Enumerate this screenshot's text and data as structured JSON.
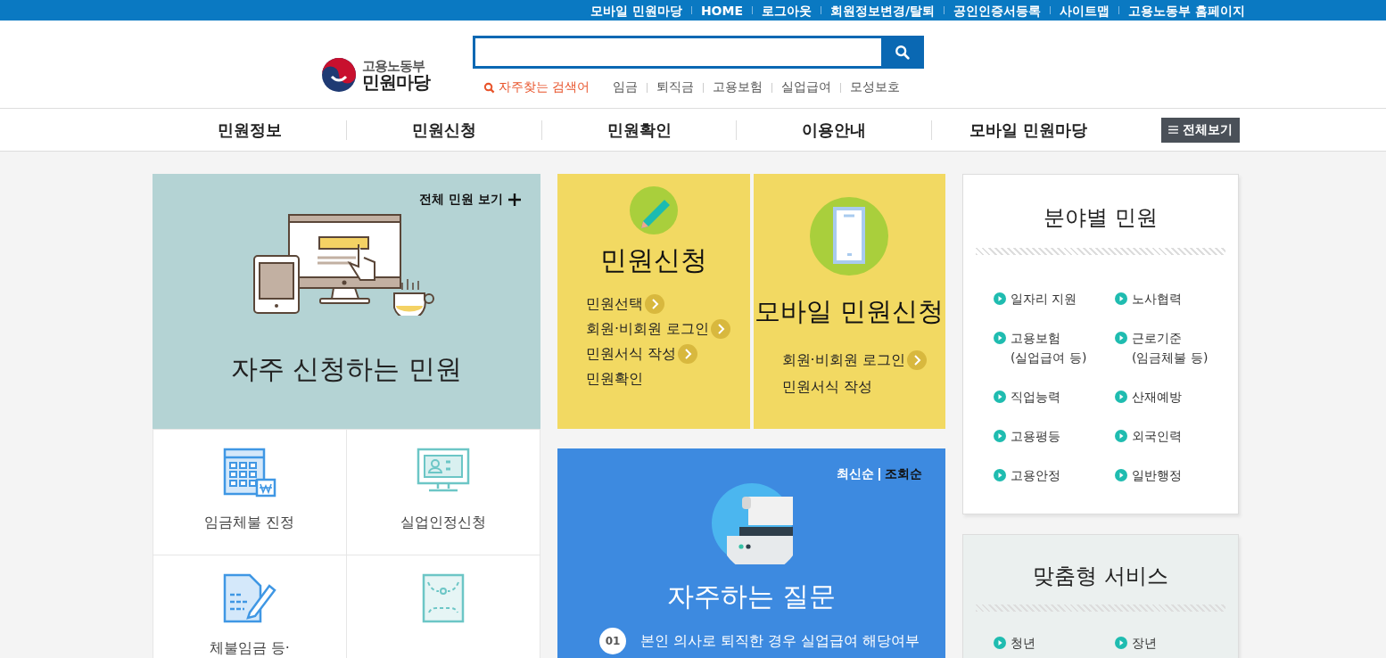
{
  "top_links": [
    "모바일 민원마당",
    "HOME",
    "로그아웃",
    "회원정보변경/탈퇴",
    "공인인증서등록",
    "사이트맵",
    "고용노동부 홈페이지"
  ],
  "logo": {
    "ministry": "고용노동부",
    "service": "민원마당"
  },
  "popular": {
    "label": "자주찾는 검색어",
    "keywords": [
      "임금",
      "퇴직금",
      "고용보험",
      "실업급여",
      "모성보호"
    ]
  },
  "nav": {
    "items": [
      "민원정보",
      "민원신청",
      "민원확인",
      "이용안내",
      "모바일 민원마당"
    ],
    "all_menu": "전체보기"
  },
  "frequent": {
    "view_all": "전체 민원 보기",
    "title": "자주 신청하는 민원",
    "tiles": [
      {
        "kind": "wage",
        "label": "임금체불 진정"
      },
      {
        "kind": "monitor",
        "label": "실업인정신청"
      },
      {
        "kind": "document",
        "label": "체불임금 등·"
      },
      {
        "kind": "envelope"
      }
    ]
  },
  "apply": {
    "title": "민원신청",
    "links": [
      {
        "label": "민원선택",
        "arrow": true
      },
      {
        "label": "회원·비회원 로그인",
        "arrow": true
      },
      {
        "label": "민원서식 작성",
        "arrow": true
      },
      {
        "label": "민원확인",
        "arrow": false
      }
    ]
  },
  "mobile": {
    "title": "모바일 민원신청",
    "links": [
      {
        "label": "회원·비회원 로그인",
        "arrow": true
      },
      {
        "label": "민원서식 작성",
        "arrow": false
      }
    ]
  },
  "faq": {
    "sort": [
      {
        "label": "최신순",
        "selected": true
      },
      {
        "label": "조회순",
        "selected": false
      }
    ],
    "title": "자주하는 질문",
    "questions": [
      {
        "number": "01",
        "text": "본인 의사로 퇴직한 경우 실업급여 해당여부"
      }
    ]
  },
  "fields": {
    "title": "분야별 민원",
    "items": [
      {
        "lines": [
          "일자리 지원"
        ]
      },
      {
        "lines": [
          "노사협력"
        ]
      },
      {
        "lines": [
          "고용보험",
          "(실업급여 등)"
        ]
      },
      {
        "lines": [
          "근로기준",
          "(임금체불 등)"
        ]
      },
      {
        "lines": [
          "직업능력"
        ]
      },
      {
        "lines": [
          "산재예방"
        ]
      },
      {
        "lines": [
          "고용평등"
        ]
      },
      {
        "lines": [
          "외국인력"
        ]
      },
      {
        "lines": [
          "고용안정"
        ]
      },
      {
        "lines": [
          "일반행정"
        ]
      }
    ]
  },
  "custom": {
    "title": "맞춤형 서비스",
    "items": [
      "청년",
      "장년"
    ]
  }
}
